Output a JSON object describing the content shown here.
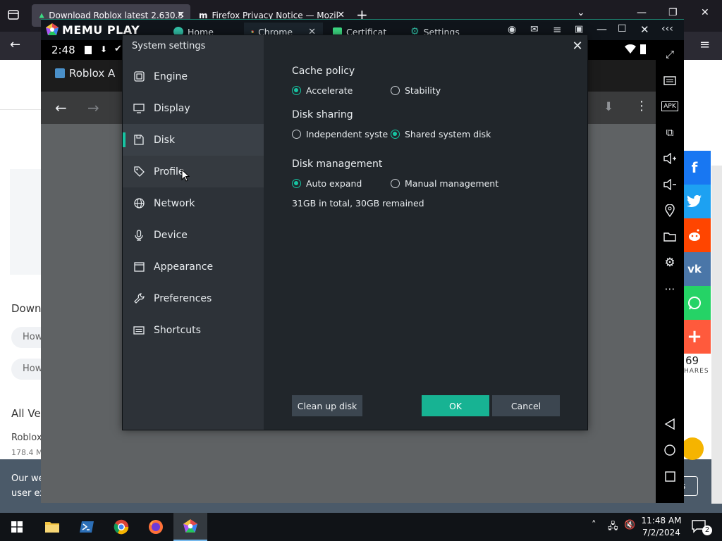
{
  "firefox": {
    "tabs": [
      {
        "label": "Download Roblox latest 2.630.5"
      },
      {
        "label": "Firefox Privacy Notice — Mozil"
      }
    ],
    "page_texts": {
      "download_heading": "Down",
      "how_1": "How",
      "how_2": "How",
      "all_versions": "All Ve",
      "roblox_item": "Roblox",
      "size": "178.4 M",
      "cookie_1": "Our we",
      "cookie_2": "user ex",
      "cookie_btn": "s"
    },
    "social": {
      "count": "69",
      "shares_label": "HARES"
    }
  },
  "memu": {
    "logo": "MEMU PLAY",
    "tabs": [
      {
        "label": "Home",
        "icon": "home-icon"
      },
      {
        "label": "Chrome",
        "icon": "chrome-icon"
      },
      {
        "label": "Certificat",
        "icon": "android-icon"
      },
      {
        "label": "Settings",
        "icon": "gear-icon"
      }
    ],
    "status_time": "2:48",
    "android_tab_title": "Roblox A"
  },
  "dialog": {
    "title": "System settings",
    "nav": [
      {
        "label": "Engine",
        "icon": "chip-icon"
      },
      {
        "label": "Display",
        "icon": "monitor-icon"
      },
      {
        "label": "Disk",
        "icon": "disk-icon"
      },
      {
        "label": "Profile",
        "icon": "tag-icon"
      },
      {
        "label": "Network",
        "icon": "globe-icon"
      },
      {
        "label": "Device",
        "icon": "microphone-icon"
      },
      {
        "label": "Appearance",
        "icon": "window-icon"
      },
      {
        "label": "Preferences",
        "icon": "wrench-icon"
      },
      {
        "label": "Shortcuts",
        "icon": "keyboard-icon"
      }
    ],
    "selected_nav": "Disk",
    "cache_policy": {
      "title": "Cache policy",
      "options": [
        {
          "label": "Accelerate",
          "selected": true
        },
        {
          "label": "Stability",
          "selected": false
        }
      ]
    },
    "disk_sharing": {
      "title": "Disk sharing",
      "options": [
        {
          "label": "Independent system d",
          "selected": false
        },
        {
          "label": "Shared system disk",
          "selected": true
        }
      ]
    },
    "disk_management": {
      "title": "Disk management",
      "options": [
        {
          "label": "Auto expand",
          "selected": true
        },
        {
          "label": "Manual management",
          "selected": false
        }
      ],
      "info": "31GB in total, 30GB remained"
    },
    "buttons": {
      "cleanup": "Clean up disk",
      "ok": "OK",
      "cancel": "Cancel"
    },
    "accent_color": "#17c4a2"
  },
  "taskbar": {
    "time": "11:48 AM",
    "date": "7/2/2024",
    "notification_count": "2"
  }
}
